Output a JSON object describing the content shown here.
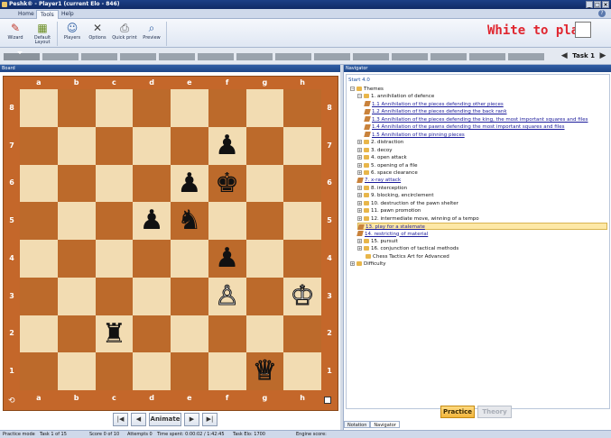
{
  "window": {
    "title": "Peshk® - Player1 (current Elo - 846)"
  },
  "menu_tabs": [
    {
      "label": "Home"
    },
    {
      "label": "Tools"
    },
    {
      "label": "Help"
    }
  ],
  "ribbon": {
    "wizard": "Wizard",
    "default_layout": "Default Layout",
    "players": "Players",
    "options": "Options",
    "quick_print": "Quick print",
    "preview": "Preview"
  },
  "turn_indicator": "White to play",
  "task": {
    "label": "Task 1"
  },
  "board": {
    "header": "Board",
    "files": [
      "a",
      "b",
      "c",
      "d",
      "e",
      "f",
      "g",
      "h"
    ],
    "ranks": [
      "8",
      "7",
      "6",
      "5",
      "4",
      "3",
      "2",
      "1"
    ],
    "pieces": [
      {
        "square": "f7",
        "type": "pawn",
        "color": "black",
        "glyph": "♟"
      },
      {
        "square": "e6",
        "type": "pawn",
        "color": "black",
        "glyph": "♟"
      },
      {
        "square": "f6",
        "type": "king",
        "color": "black",
        "glyph": "♚"
      },
      {
        "square": "d5",
        "type": "pawn",
        "color": "black",
        "glyph": "♟"
      },
      {
        "square": "e5",
        "type": "knight",
        "color": "black",
        "glyph": "♞"
      },
      {
        "square": "f4",
        "type": "pawn",
        "color": "black",
        "glyph": "♟"
      },
      {
        "square": "f3",
        "type": "pawn",
        "color": "white",
        "glyph": "♙"
      },
      {
        "square": "h3",
        "type": "king",
        "color": "white",
        "glyph": "♔"
      },
      {
        "square": "c2",
        "type": "rook",
        "color": "black",
        "glyph": "♜"
      },
      {
        "square": "g1",
        "type": "queen",
        "color": "white",
        "glyph": "♕"
      }
    ]
  },
  "navigation": {
    "first": "|◀",
    "prev": "◀",
    "animate": "Animate",
    "next": "▶",
    "last": "▶|"
  },
  "navigator": {
    "header": "Navigator",
    "root": "Start 4.0",
    "items": [
      {
        "label": "Themes",
        "kind": "folder",
        "level": 0,
        "expand": "−"
      },
      {
        "label": "1. annihilation of defence",
        "kind": "folder",
        "level": 1,
        "expand": "−"
      },
      {
        "label": "1.1 Annihilation of the pieces defending other pieces",
        "kind": "task",
        "level": 2,
        "link": true
      },
      {
        "label": "1.2 Annihilation of the pieces defending the back rank",
        "kind": "task",
        "level": 2,
        "link": true
      },
      {
        "label": "1.3 Annihilation of the pieces defending the king, the most important squares and files",
        "kind": "task",
        "level": 2,
        "link": true
      },
      {
        "label": "1.4 Annihilation of the pawns defending the most important squares and files",
        "kind": "task",
        "level": 2,
        "link": true
      },
      {
        "label": "1.5 Annihilation of the pinning pieces",
        "kind": "task",
        "level": 2,
        "link": true
      },
      {
        "label": "2. distraction",
        "kind": "folder",
        "level": 1,
        "expand": "+"
      },
      {
        "label": "3. decoy",
        "kind": "folder",
        "level": 1,
        "expand": "+"
      },
      {
        "label": "4. open attack",
        "kind": "folder",
        "level": 1,
        "expand": "+"
      },
      {
        "label": "5. opening of a file",
        "kind": "folder",
        "level": 1,
        "expand": "+"
      },
      {
        "label": "6. space clearance",
        "kind": "folder",
        "level": 1,
        "expand": "+"
      },
      {
        "label": "7. x-ray attack",
        "kind": "task",
        "level": 1,
        "link": true
      },
      {
        "label": "8. interception",
        "kind": "folder",
        "level": 1,
        "expand": "+"
      },
      {
        "label": "9. blocking, encirclement",
        "kind": "folder",
        "level": 1,
        "expand": "+"
      },
      {
        "label": "10. destruction of the pawn shelter",
        "kind": "folder",
        "level": 1,
        "expand": "+"
      },
      {
        "label": "11. pawn promotion",
        "kind": "folder",
        "level": 1,
        "expand": "+"
      },
      {
        "label": "12. intermediate move, winning of a tempo",
        "kind": "folder",
        "level": 1,
        "expand": "+"
      },
      {
        "label": "13. play for a stalemate",
        "kind": "task",
        "level": 1,
        "link": true,
        "selected": true
      },
      {
        "label": "14. restricting of material",
        "kind": "task",
        "level": 1,
        "link": true
      },
      {
        "label": "15. pursuit",
        "kind": "folder",
        "level": 1,
        "expand": "+"
      },
      {
        "label": "16. conjunction of tactical methods",
        "kind": "folder",
        "level": 1,
        "expand": "+"
      },
      {
        "label": "Chess Tactics Art for Advanced",
        "kind": "folder",
        "level": 1,
        "expand": ""
      },
      {
        "label": "Difficulty",
        "kind": "folder",
        "level": 0,
        "expand": "+"
      }
    ],
    "practice_label": "Practice",
    "theory_label": "Theory",
    "tabs": [
      "Notation",
      "Navigator"
    ]
  },
  "status": {
    "mode": "Practice mode",
    "task": "Task 1 of 15",
    "score": "Score 0 of 10",
    "attempts": "Attempts 0",
    "time": "Time spent: 0:00:02 / 1:42:45",
    "elo": "Task Elo: 1700",
    "engine": "Engine score:"
  }
}
